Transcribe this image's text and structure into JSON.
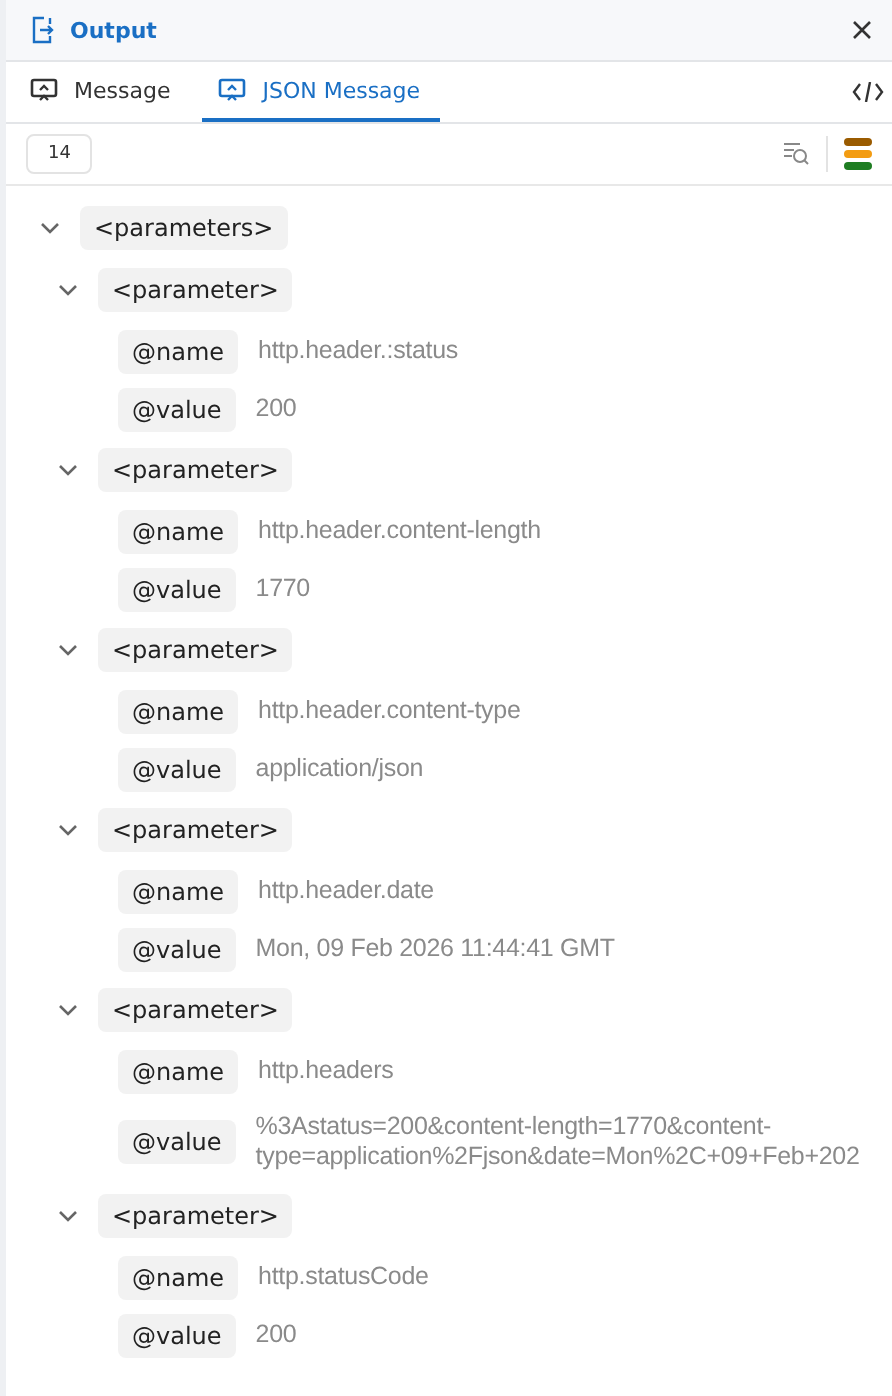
{
  "panel": {
    "title": "Output"
  },
  "tabs": [
    {
      "label": "Message",
      "selected": false
    },
    {
      "label": "JSON Message",
      "selected": true
    }
  ],
  "toolbar": {
    "count": "14"
  },
  "tree": {
    "tag": "<parameters>",
    "expanded": true,
    "children": [
      {
        "tag": "<parameter>",
        "expanded": true,
        "attributes": [
          {
            "key": "@name",
            "value": "http.header.:status"
          },
          {
            "key": "@value",
            "value": "200"
          }
        ]
      },
      {
        "tag": "<parameter>",
        "expanded": true,
        "attributes": [
          {
            "key": "@name",
            "value": "http.header.content-length"
          },
          {
            "key": "@value",
            "value": "1770"
          }
        ]
      },
      {
        "tag": "<parameter>",
        "expanded": true,
        "attributes": [
          {
            "key": "@name",
            "value": "http.header.content-type"
          },
          {
            "key": "@value",
            "value": "application/json"
          }
        ]
      },
      {
        "tag": "<parameter>",
        "expanded": true,
        "attributes": [
          {
            "key": "@name",
            "value": "http.header.date"
          },
          {
            "key": "@value",
            "value": "Mon, 09 Feb 2026 11:44:41 GMT"
          }
        ]
      },
      {
        "tag": "<parameter>",
        "expanded": true,
        "attributes": [
          {
            "key": "@name",
            "value": "http.headers"
          },
          {
            "key": "@value",
            "value": "%3Astatus=200&content-length=1770&content-type=application%2Fjson&date=Mon%2C+09+Feb+202"
          }
        ]
      },
      {
        "tag": "<parameter>",
        "expanded": true,
        "attributes": [
          {
            "key": "@name",
            "value": "http.statusCode"
          },
          {
            "key": "@value",
            "value": "200"
          }
        ]
      }
    ]
  }
}
